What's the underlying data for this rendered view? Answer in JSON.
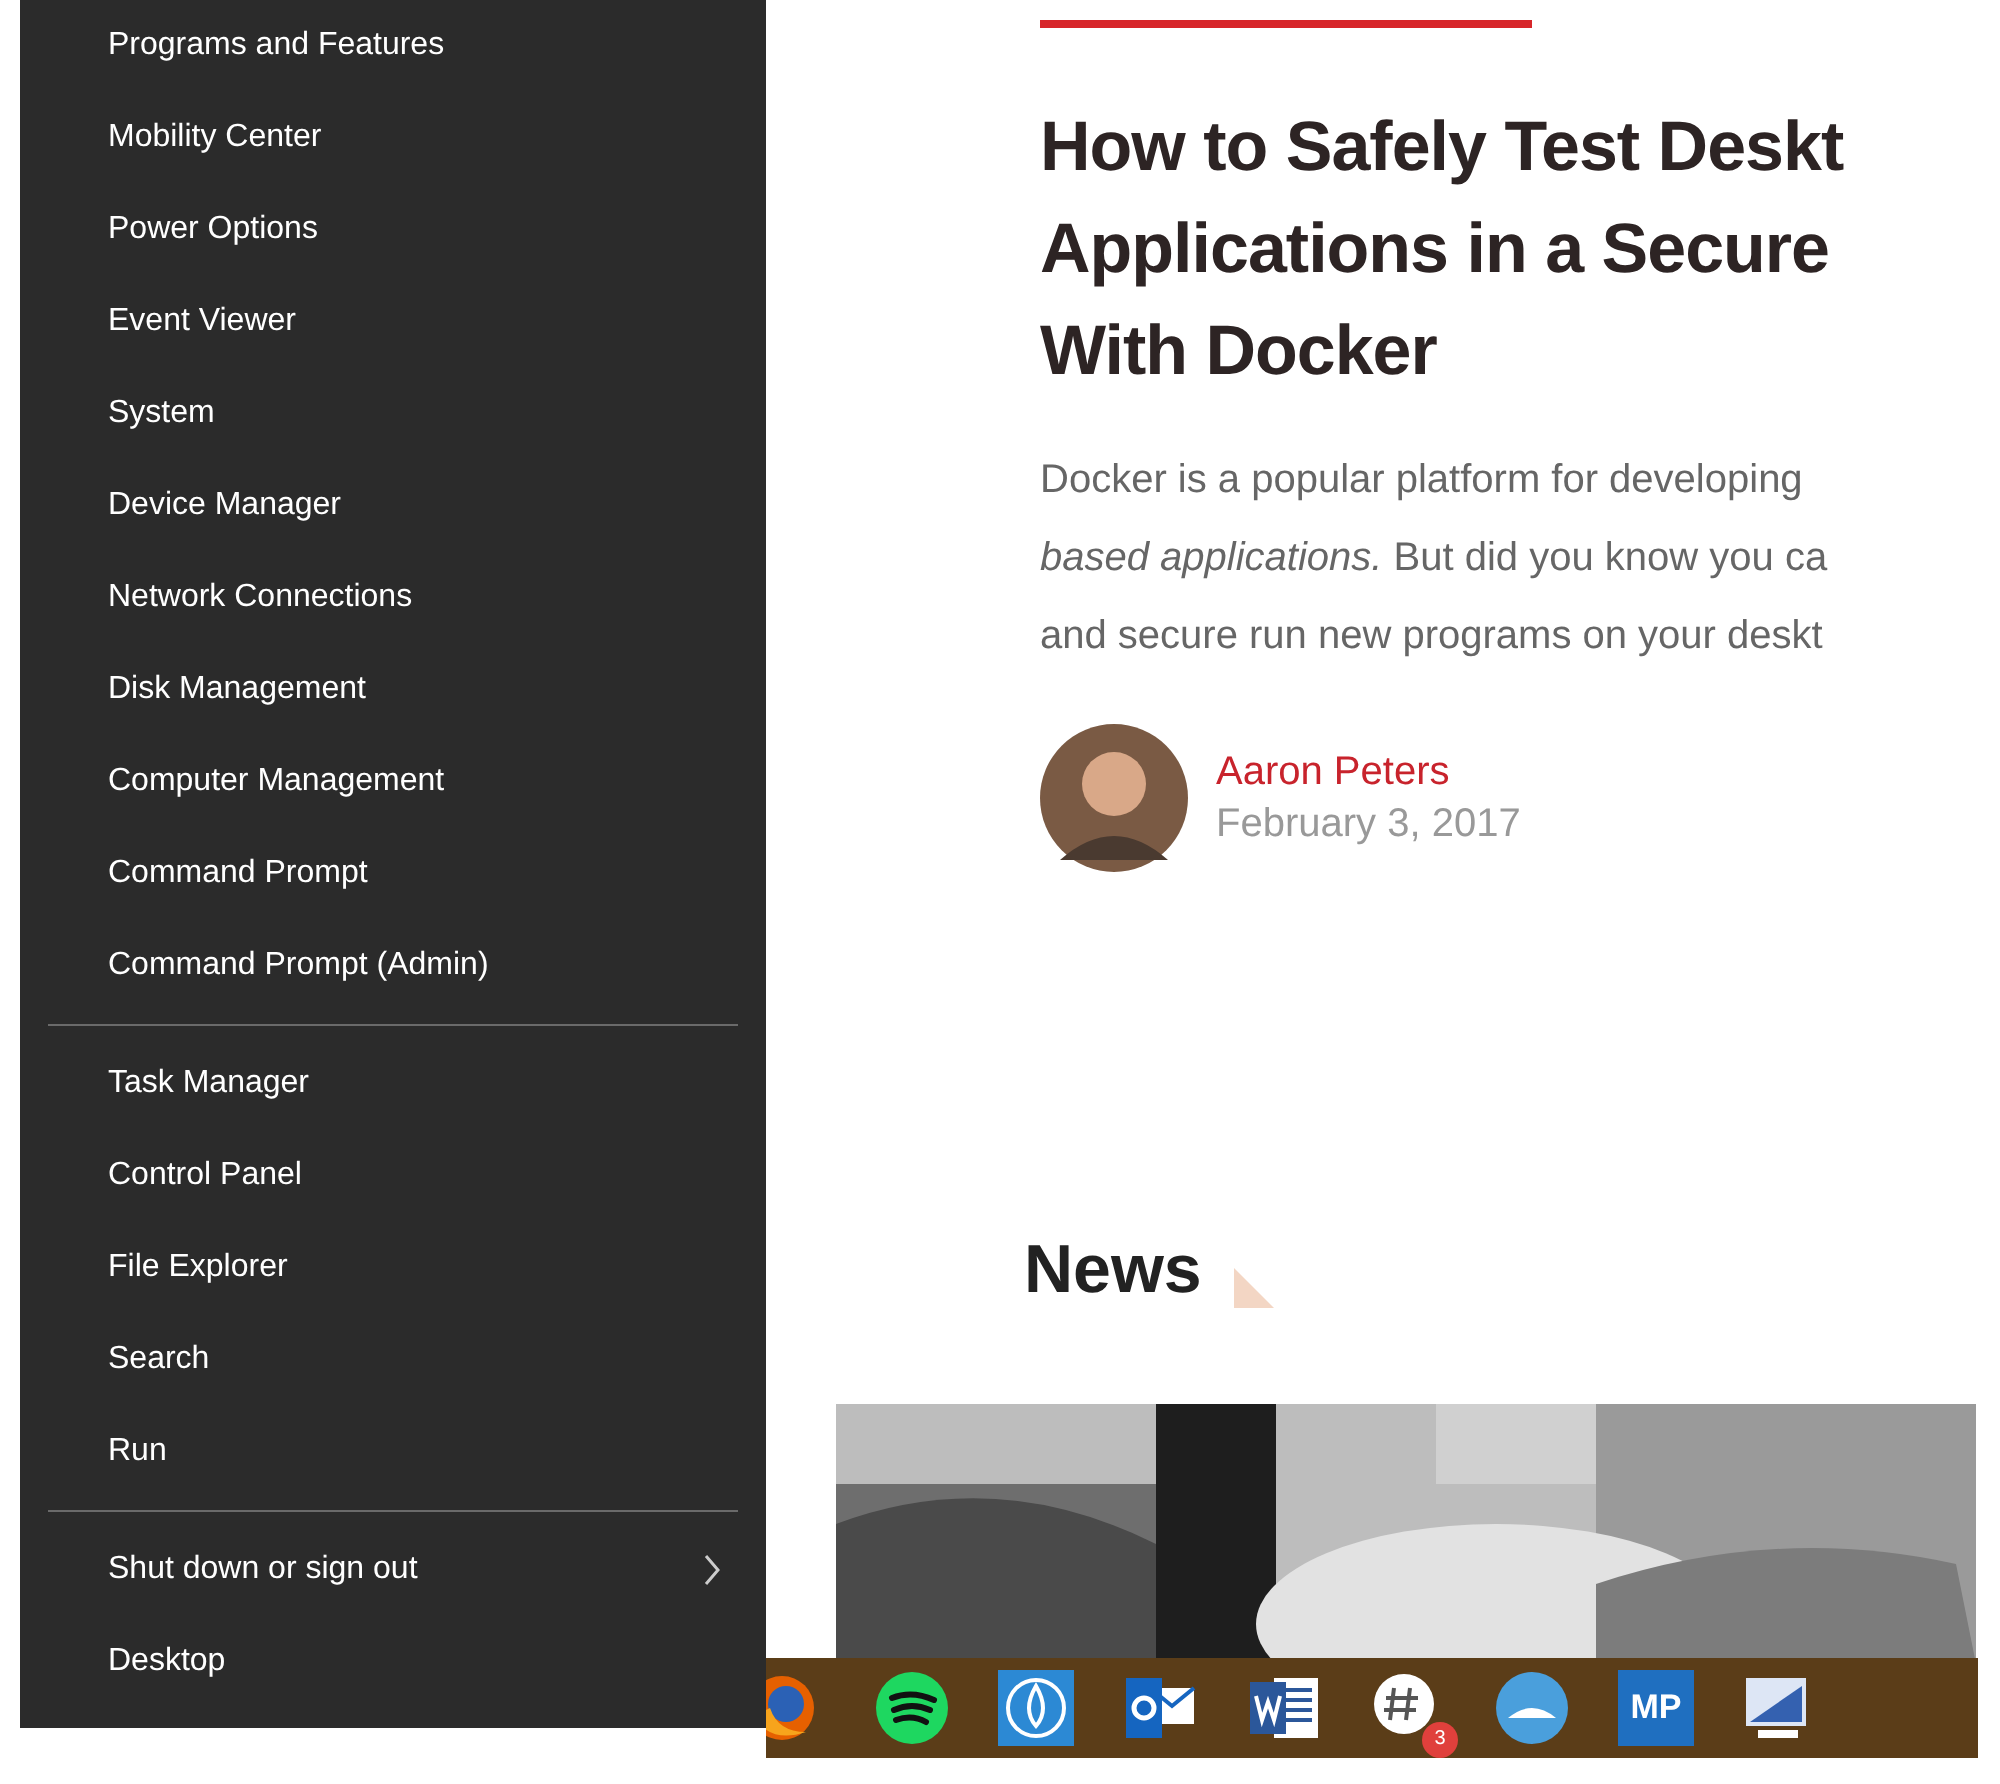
{
  "menu": {
    "groups": [
      {
        "items": [
          {
            "label": "Programs and Features",
            "kind": "plain"
          },
          {
            "label": "Mobility Center",
            "kind": "plain"
          },
          {
            "label": "Power Options",
            "kind": "plain"
          },
          {
            "label": "Event Viewer",
            "kind": "plain"
          },
          {
            "label": "System",
            "kind": "plain"
          },
          {
            "label": "Device Manager",
            "kind": "plain"
          },
          {
            "label": "Network Connections",
            "kind": "plain"
          },
          {
            "label": "Disk Management",
            "kind": "plain"
          },
          {
            "label": "Computer Management",
            "kind": "plain"
          },
          {
            "label": "Command Prompt",
            "kind": "plain"
          },
          {
            "label": "Command Prompt (Admin)",
            "kind": "plain"
          }
        ]
      },
      {
        "items": [
          {
            "label": "Task Manager",
            "kind": "plain"
          },
          {
            "label": "Control Panel",
            "kind": "plain"
          },
          {
            "label": "File Explorer",
            "kind": "plain"
          },
          {
            "label": "Search",
            "kind": "plain"
          },
          {
            "label": "Run",
            "kind": "plain"
          }
        ]
      },
      {
        "items": [
          {
            "label": "Shut down or sign out",
            "kind": "submenu"
          },
          {
            "label": "Desktop",
            "kind": "plain"
          }
        ]
      }
    ]
  },
  "article": {
    "title_lines": [
      "How to Safely Test Deskt",
      "Applications in a Secure",
      "With Docker"
    ],
    "summary_lines": [
      "Docker is a popular platform for developing",
      "*based applications.* But did you know you ca",
      "and secure run new programs on your deskt"
    ],
    "author": "Aaron Peters",
    "date": "February 3, 2017"
  },
  "news": {
    "heading": "News"
  },
  "taskbar": {
    "apps": [
      {
        "kind": "firefox"
      },
      {
        "kind": "spotify"
      },
      {
        "kind": "drop"
      },
      {
        "kind": "outlook"
      },
      {
        "kind": "word"
      },
      {
        "kind": "chat",
        "badge": "3"
      },
      {
        "kind": "globe"
      },
      {
        "kind": "tile",
        "label": "MP"
      },
      {
        "kind": "screen"
      }
    ]
  }
}
